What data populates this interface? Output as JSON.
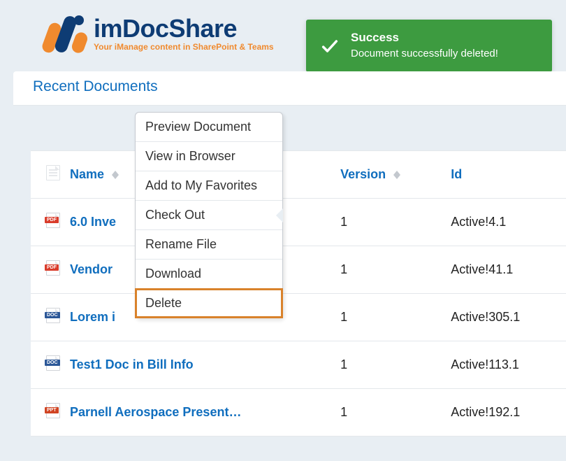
{
  "logo": {
    "brand": "imDocShare",
    "tagline": "Your iManage content in SharePoint & Teams"
  },
  "toast": {
    "title": "Success",
    "message": "Document successfully deleted!"
  },
  "section_title": "Recent Documents",
  "columns": {
    "name": "Name",
    "version": "Version",
    "id": "Id"
  },
  "rows": [
    {
      "type": "pdf",
      "name": "6.0 Inve",
      "version": "1",
      "id": "Active!4.1"
    },
    {
      "type": "pdf",
      "name": "Vendor",
      "version": "1",
      "id": "Active!41.1"
    },
    {
      "type": "doc",
      "name": "Lorem i",
      "version": "1",
      "id": "Active!305.1"
    },
    {
      "type": "doc",
      "name": "Test1 Doc in Bill Info",
      "version": "1",
      "id": "Active!113.1"
    },
    {
      "type": "ppt",
      "name": "Parnell Aerospace Present…",
      "version": "1",
      "id": "Active!192.1"
    }
  ],
  "context_menu": [
    {
      "label": "Preview Document",
      "highlight": false,
      "submenu": false
    },
    {
      "label": "View in Browser",
      "highlight": false,
      "submenu": false
    },
    {
      "label": "Add to My Favorites",
      "highlight": false,
      "submenu": false
    },
    {
      "label": "Check Out",
      "highlight": false,
      "submenu": true
    },
    {
      "label": "Rename File",
      "highlight": false,
      "submenu": false
    },
    {
      "label": "Download",
      "highlight": false,
      "submenu": false
    },
    {
      "label": "Delete",
      "highlight": true,
      "submenu": false
    }
  ]
}
